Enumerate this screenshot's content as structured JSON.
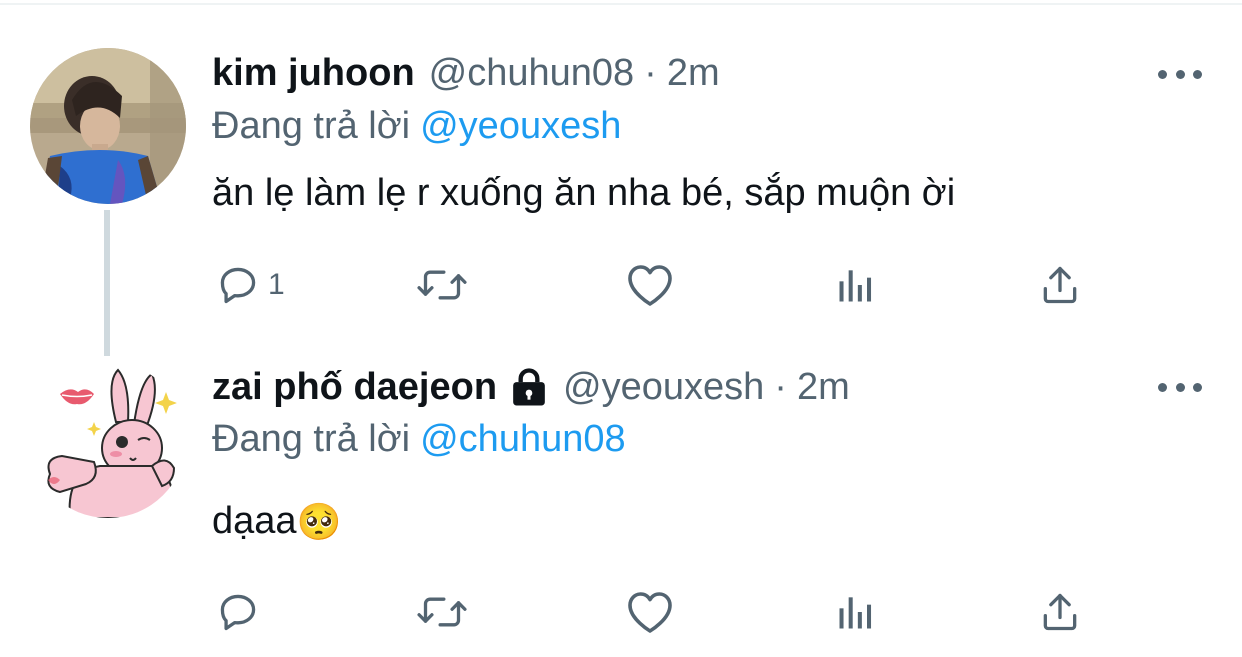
{
  "tweets": [
    {
      "display_name": "kim juhoon",
      "handle": "@chuhun08",
      "separator": "·",
      "time": "2m",
      "reply_prefix": "Đang trả lời",
      "reply_to": "@yeouxesh",
      "text": "ăn lẹ làm lẹ r xuống ăn nha bé, sắp muộn ời",
      "protected": false,
      "reply_count": "1"
    },
    {
      "display_name": "zai phố daejeon",
      "handle": "@yeouxesh",
      "separator": "·",
      "time": "2m",
      "reply_prefix": "Đang trả lời",
      "reply_to": "@chuhun08",
      "text": "dạaa",
      "emoji": "🥺",
      "protected": true,
      "reply_count": ""
    }
  ],
  "icons": [
    "reply-icon",
    "retweet-icon",
    "like-icon",
    "analytics-icon",
    "share-icon",
    "more-icon",
    "lock-icon"
  ],
  "colors": {
    "text": "#0f1419",
    "secondary": "#536471",
    "accent": "#1d9bf0",
    "thread_line": "#cfd9de",
    "background": "#ffffff"
  }
}
